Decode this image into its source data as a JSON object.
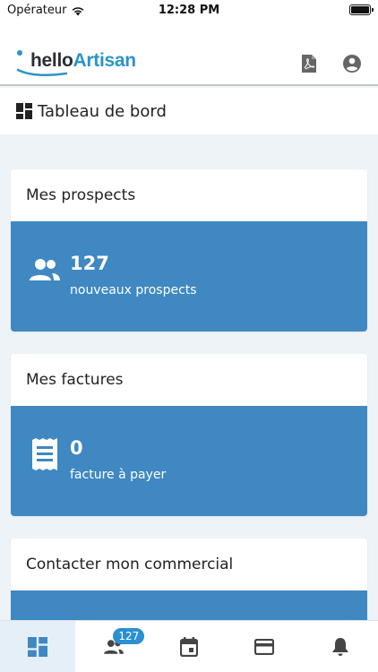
{
  "status_bar": {
    "carrier": "Opérateur",
    "time": "12:28 PM"
  },
  "header": {
    "logo_hello": "hello",
    "logo_artisan": "Artisan",
    "icons": [
      "pdf-icon",
      "account-circle-icon"
    ]
  },
  "page": {
    "title": "Tableau de bord",
    "title_icon": "dashboard-icon"
  },
  "cards": [
    {
      "title": "Mes prospects",
      "icon": "people-icon",
      "value": "127",
      "caption": "nouveaux prospects"
    },
    {
      "title": "Mes factures",
      "icon": "receipt-icon",
      "value": "0",
      "caption": "facture à payer"
    },
    {
      "title": "Contacter mon commercial"
    }
  ],
  "bottom_nav": {
    "items": [
      {
        "icon": "dashboard-icon",
        "active": true
      },
      {
        "icon": "people-icon",
        "badge": "127"
      },
      {
        "icon": "calendar-icon"
      },
      {
        "icon": "credit-card-icon"
      },
      {
        "icon": "bell-icon"
      }
    ]
  },
  "colors": {
    "accent": "#3f88c2",
    "brand": "#2b93c9",
    "background": "#eef3f7",
    "badge": "#2b8fd0"
  }
}
